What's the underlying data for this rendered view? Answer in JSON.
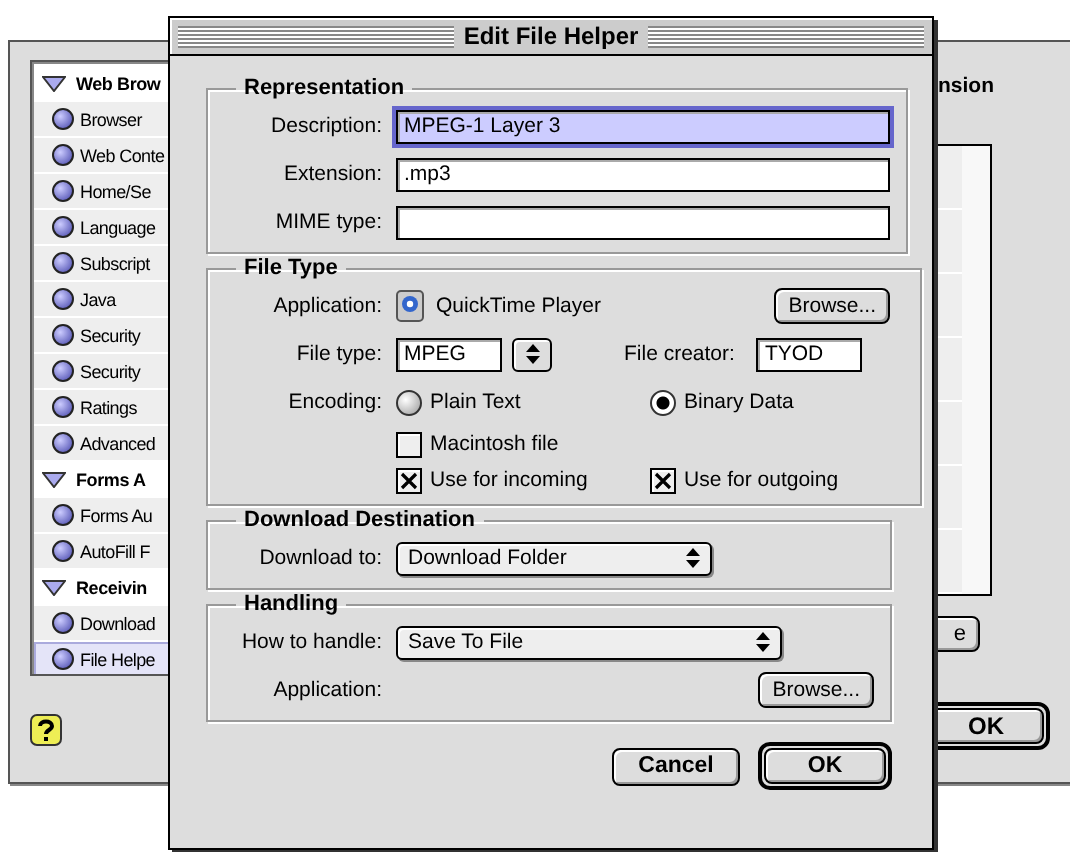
{
  "background_window": {
    "sidebar": [
      {
        "label": "Web Brow",
        "expanded": true,
        "children": [
          {
            "label": "Browser",
            "selected": false
          },
          {
            "label": "Web Conte",
            "selected": false
          },
          {
            "label": "Home/Se",
            "selected": false
          },
          {
            "label": "Language",
            "selected": false
          },
          {
            "label": "Subscript",
            "selected": false
          },
          {
            "label": "Java",
            "selected": false
          },
          {
            "label": "Security",
            "selected": false
          },
          {
            "label": "Security",
            "selected": false
          },
          {
            "label": "Ratings",
            "selected": false
          },
          {
            "label": "Advanced",
            "selected": false
          }
        ]
      },
      {
        "label": "Forms A",
        "expanded": true,
        "children": [
          {
            "label": "Forms Au",
            "selected": false
          },
          {
            "label": "AutoFill F",
            "selected": false
          }
        ]
      },
      {
        "label": "Receivin",
        "expanded": true,
        "children": [
          {
            "label": "Download",
            "selected": false
          },
          {
            "label": "File Helpe",
            "selected": true
          }
        ]
      }
    ],
    "column_header": "nsion",
    "side_button": "e",
    "ok_button": "OK"
  },
  "dialog": {
    "title": "Edit File Helper",
    "representation": {
      "title": "Representation",
      "fields": [
        {
          "label": "Description:",
          "value": "MPEG-1 Layer 3",
          "focused": true
        },
        {
          "label": "Extension:",
          "value": ".mp3",
          "focused": false
        },
        {
          "label": "MIME type:",
          "focused": false
        }
      ]
    },
    "file_type": {
      "title": "File Type",
      "application_label": "Application:",
      "application": "QuickTime Player",
      "browse": "Browse...",
      "type_label": "File type:",
      "type_value": "MPEG",
      "creator_label": "File creator:",
      "creator_value": "TYOD",
      "encoding_label": "Encoding:",
      "encodings": [
        {
          "label": "Plain Text",
          "selected": false
        },
        {
          "label": "Binary Data",
          "selected": true
        }
      ],
      "options": [
        {
          "label": "Macintosh file",
          "checked": false
        },
        {
          "label": "Use for incoming",
          "checked": true
        },
        {
          "label": "Use for outgoing",
          "checked": true
        }
      ]
    },
    "download": {
      "title": "Download Destination",
      "label": "Download to:",
      "value": "Download Folder"
    },
    "handling": {
      "title": "Handling",
      "label": "How to handle:",
      "value": "Save To File",
      "application_label": "Application:",
      "browse": "Browse..."
    },
    "buttons": [
      {
        "label": "Cancel",
        "default": false
      },
      {
        "label": "OK",
        "default": true
      }
    ]
  }
}
